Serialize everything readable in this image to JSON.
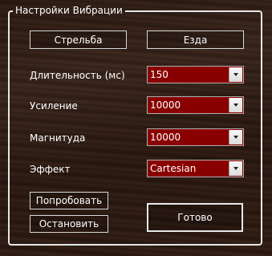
{
  "group": {
    "title": "Настройки Вибрации"
  },
  "mode_buttons": {
    "shooting": "Стрельба",
    "driving": "Езда"
  },
  "fields": [
    {
      "label": "Длительность (мс)",
      "value": "150"
    },
    {
      "label": "Усиление",
      "value": "10000"
    },
    {
      "label": "Магнитуда",
      "value": "10000"
    },
    {
      "label": "Эффект",
      "value": "Cartesian"
    }
  ],
  "actions": {
    "try": "Попробовать",
    "stop": "Остановить",
    "done": "Готово"
  }
}
